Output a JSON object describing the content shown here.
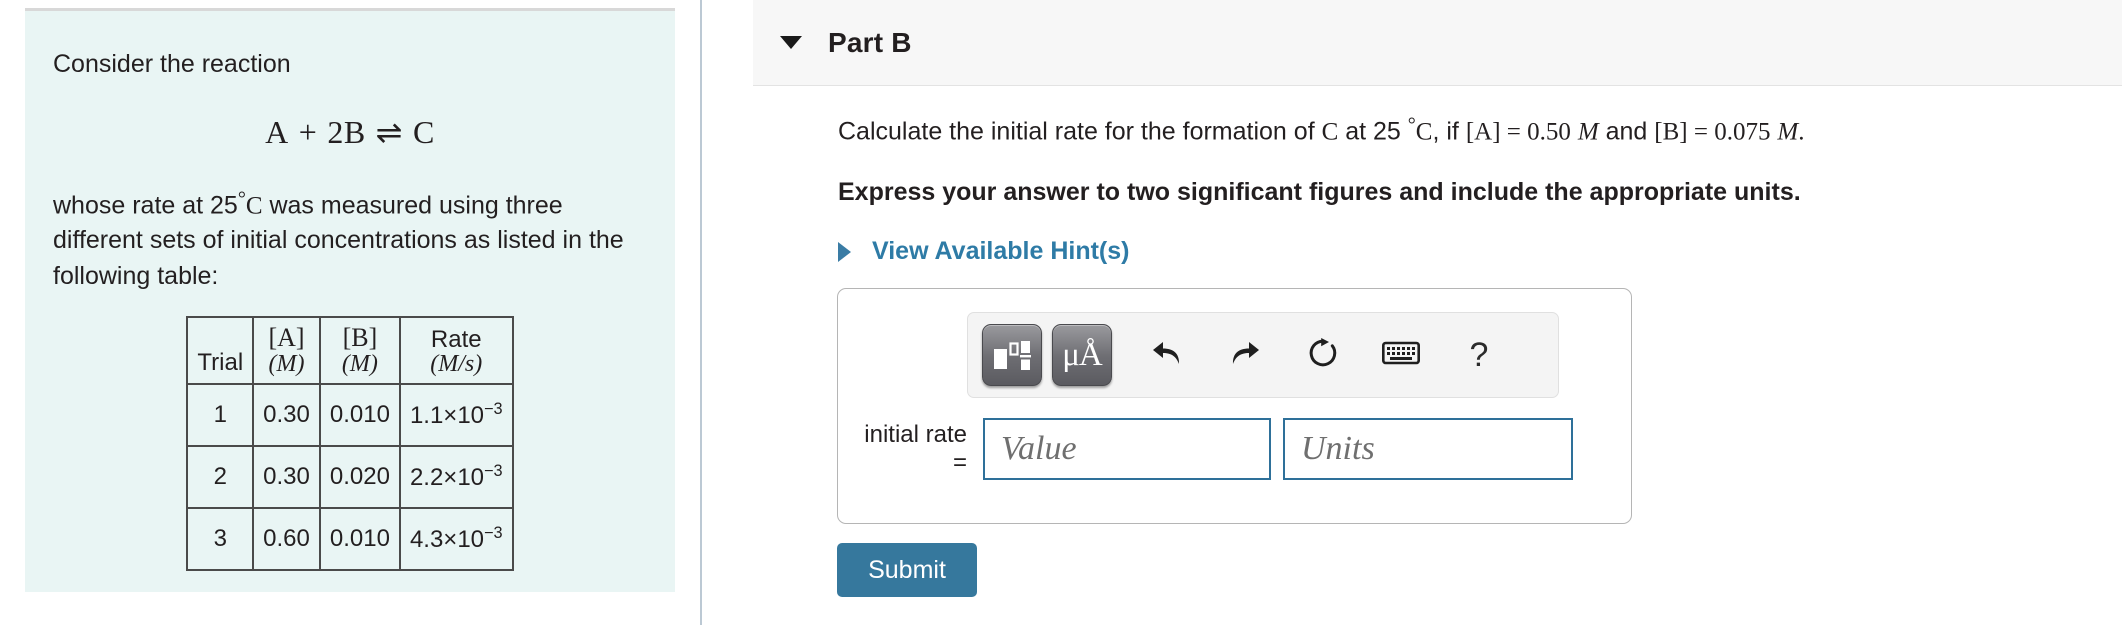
{
  "problem": {
    "intro": "Consider the reaction",
    "reaction": {
      "left": "A",
      "plus": "+",
      "coefficient_b": "2B",
      "arrow": "⇌",
      "right": "C",
      "full_text": "A + 2B ⇌ C"
    },
    "description_pre": "whose rate at 25",
    "description_degree": "°",
    "description_unit": "C",
    "description_post": " was measured using three different sets of initial concentrations as listed in the following table:",
    "table": {
      "headers": [
        {
          "top": "",
          "bot": "Trial",
          "kind": "trial"
        },
        {
          "top": "[A]",
          "bot": "(M)",
          "kind": "stack"
        },
        {
          "top": "[B]",
          "bot": "(M)",
          "kind": "stack"
        },
        {
          "top": "Rate",
          "bot": "(M/s)",
          "kind": "stack-sans"
        }
      ],
      "rows": [
        {
          "trial": "1",
          "a": "0.30",
          "b": "0.010",
          "rate_mantissa": "1.1×10",
          "rate_exponent": "−3"
        },
        {
          "trial": "2",
          "a": "0.30",
          "b": "0.020",
          "rate_mantissa": "2.2×10",
          "rate_exponent": "−3"
        },
        {
          "trial": "3",
          "a": "0.60",
          "b": "0.010",
          "rate_mantissa": "4.3×10",
          "rate_exponent": "−3"
        }
      ]
    }
  },
  "part": {
    "title": "Part B",
    "caret_icon": "caret-down-icon",
    "question": {
      "seg1": "Calculate the initial rate for the formation of ",
      "species": "C",
      "seg2": " at 25 ",
      "degree": "°",
      "temp_unit": "C",
      "seg3": ", if ",
      "conc_a": "[A]",
      "eq1": " = ",
      "val_a": "0.50",
      "unit_a": "M",
      "seg4": " and ",
      "conc_b": "[B]",
      "eq2": " = ",
      "val_b": "0.075",
      "unit_b": "M",
      "period": "."
    },
    "instruction": "Express your answer to two significant figures and include the appropriate units.",
    "hints_label": "View Available Hint(s)",
    "hints_caret_icon": "caret-right-icon"
  },
  "toolbar": {
    "buttons": [
      {
        "name": "template-palette-button",
        "icon": "math-template-icon",
        "active": true
      },
      {
        "name": "units-palette-button",
        "icon": "mu-angstrom-icon",
        "label": "μÅ",
        "active": true
      },
      {
        "name": "undo-button",
        "icon": "undo-arrow-icon",
        "label": "↰"
      },
      {
        "name": "redo-button",
        "icon": "redo-arrow-icon",
        "label": "↱"
      },
      {
        "name": "reset-button",
        "icon": "reset-circular-arrow-icon",
        "label": "↻"
      },
      {
        "name": "keyboard-button",
        "icon": "keyboard-icon",
        "label": "⌨"
      },
      {
        "name": "help-button",
        "icon": "question-mark-icon",
        "label": "?"
      }
    ]
  },
  "answer": {
    "label": "initial rate =",
    "value_placeholder": "Value",
    "value_current": "",
    "units_placeholder": "Units",
    "units_current": ""
  },
  "actions": {
    "submit_label": "Submit"
  },
  "colors": {
    "panel_background": "#e9f5f4",
    "accent_blue": "#2e7ba6",
    "submit_blue": "#36789d",
    "input_border": "#2e7099",
    "header_background": "#f7f7f7",
    "divider": "#bcc9d4"
  }
}
